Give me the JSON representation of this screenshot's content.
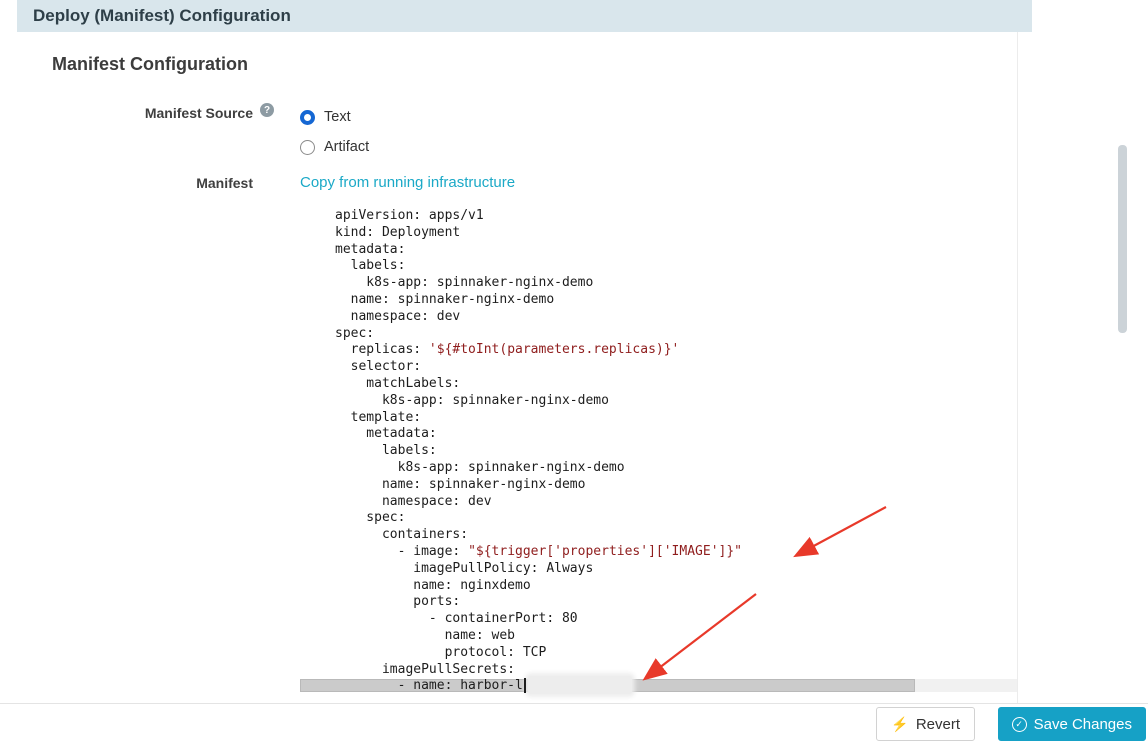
{
  "header": {
    "title": "Deploy (Manifest) Configuration"
  },
  "section": {
    "title": "Manifest Configuration"
  },
  "manifest_source": {
    "label": "Manifest Source",
    "help_icon": "question-mark",
    "options": [
      {
        "label": "Text",
        "selected": true
      },
      {
        "label": "Artifact",
        "selected": false
      }
    ]
  },
  "manifest": {
    "label": "Manifest",
    "copy_link": "Copy from running infrastructure",
    "code_lines": [
      "apiVersion: apps/v1",
      "kind: Deployment",
      "metadata:",
      "  labels:",
      "    k8s-app: spinnaker-nginx-demo",
      "  name: spinnaker-nginx-demo",
      "  namespace: dev",
      "spec:",
      "  replicas: '${#toInt(parameters.replicas)}'",
      "  selector:",
      "    matchLabels:",
      "      k8s-app: spinnaker-nginx-demo",
      "  template:",
      "    metadata:",
      "      labels:",
      "        k8s-app: spinnaker-nginx-demo",
      "      name: spinnaker-nginx-demo",
      "      namespace: dev",
      "    spec:",
      "      containers:",
      "        - image: \"${trigger['properties']['IMAGE']}\"",
      "          imagePullPolicy: Always",
      "          name: nginxdemo",
      "          ports:",
      "            - containerPort: 80",
      "              name: web",
      "              protocol: TCP",
      "      imagePullSecrets:",
      "        - name: harbor-l"
    ]
  },
  "footer": {
    "revert_label": "Revert",
    "save_label": "Save Changes",
    "revert_icon": "lightning-bolt",
    "save_icon": "check-circle"
  },
  "colors": {
    "header_bg": "#d9e6ec",
    "link": "#1ba9c7",
    "save_button": "#16a1c6",
    "radio_selected": "#1567d3",
    "code_string": "#8f1d1d",
    "annotation_arrow": "#e8392a",
    "help_icon_bg": "#8d9ba3"
  }
}
